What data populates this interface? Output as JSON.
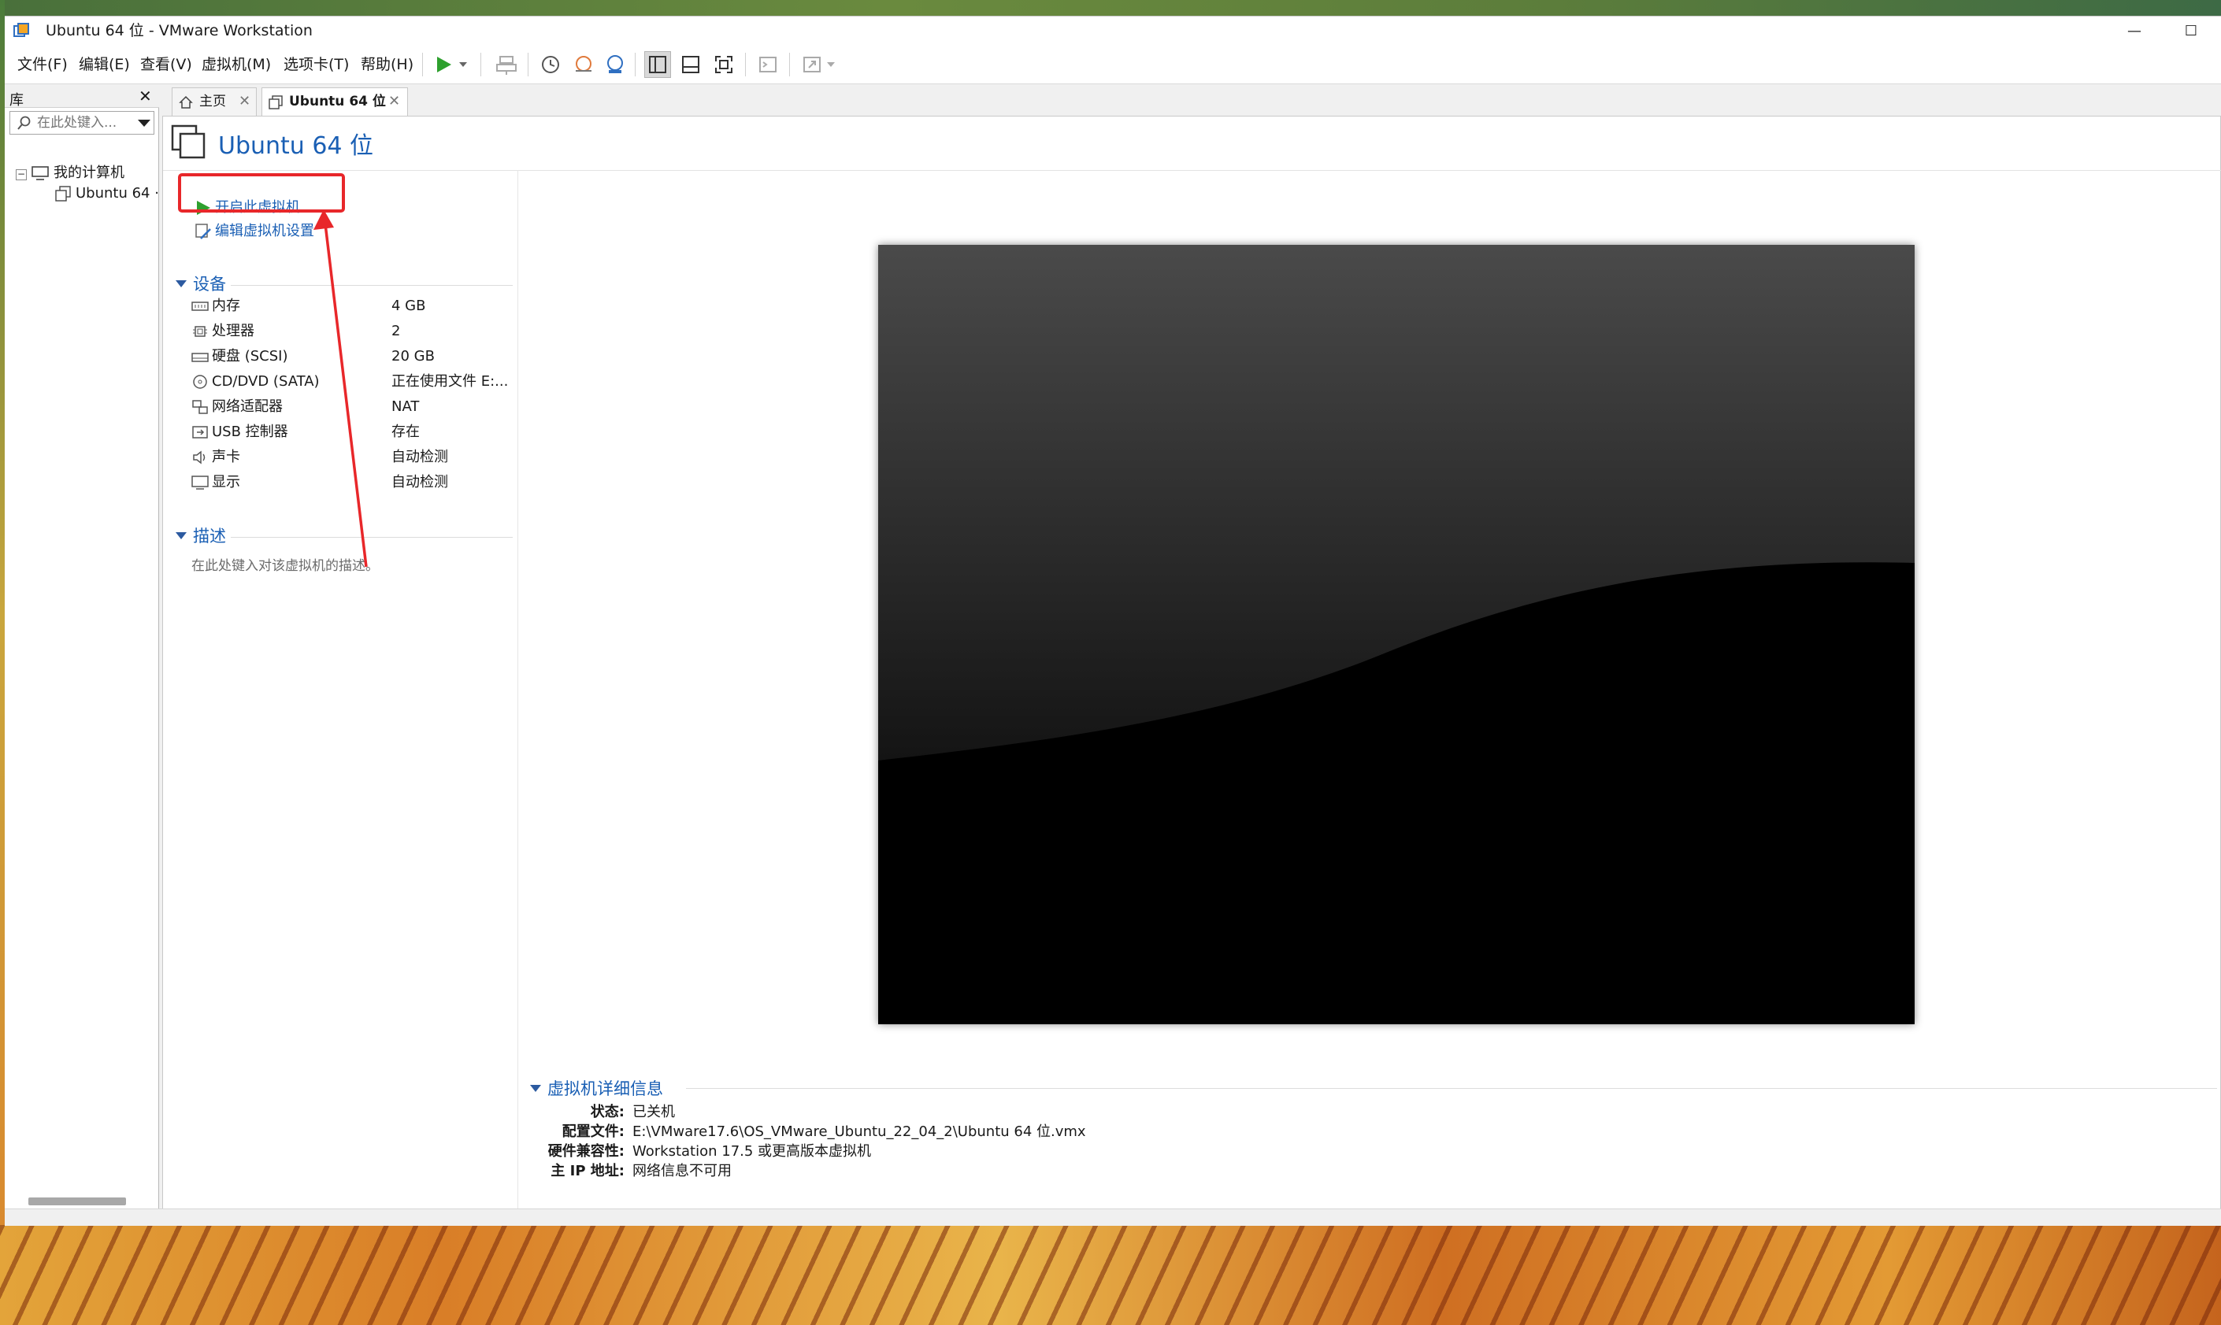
{
  "window": {
    "title": "Ubuntu 64 位 - VMware Workstation",
    "minimize_glyph": "—",
    "maximize_glyph": "☐"
  },
  "menu": {
    "file": "文件(F)",
    "edit": "编辑(E)",
    "view": "查看(V)",
    "vm": "虚拟机(M)",
    "tabs": "选项卡(T)",
    "help": "帮助(H)"
  },
  "library": {
    "title": "库",
    "close_glyph": "✕",
    "search_placeholder": "在此处键入...",
    "tree": {
      "root": "我的计算机",
      "child": "Ubuntu 64 ·"
    }
  },
  "tabs": [
    {
      "label": "主页",
      "close": "✕"
    },
    {
      "label": "Ubuntu 64 位",
      "close": "✕"
    }
  ],
  "vm": {
    "title": "Ubuntu 64 位",
    "actions": {
      "power_on": "开启此虚拟机",
      "edit_settings": "编辑虚拟机设置"
    },
    "devices": {
      "heading": "设备",
      "rows": [
        {
          "name": "内存",
          "value": "4 GB",
          "icon": "memory-icon"
        },
        {
          "name": "处理器",
          "value": "2",
          "icon": "cpu-icon"
        },
        {
          "name": "硬盘 (SCSI)",
          "value": "20 GB",
          "icon": "hard-disk-icon"
        },
        {
          "name": "CD/DVD (SATA)",
          "value": "正在使用文件 E:...",
          "icon": "cd-dvd-icon"
        },
        {
          "name": "网络适配器",
          "value": "NAT",
          "icon": "network-adapter-icon"
        },
        {
          "name": "USB 控制器",
          "value": "存在",
          "icon": "usb-icon"
        },
        {
          "name": "声卡",
          "value": "自动检测",
          "icon": "sound-icon"
        },
        {
          "name": "显示",
          "value": "自动检测",
          "icon": "display-icon"
        }
      ]
    },
    "description": {
      "heading": "描述",
      "placeholder": "在此处键入对该虚拟机的描述。"
    },
    "details": {
      "heading": "虚拟机详细信息",
      "rows": [
        {
          "key": "状态:",
          "value": "已关机"
        },
        {
          "key": "配置文件:",
          "value": "E:\\VMware17.6\\OS_VMware_Ubuntu_22_04_2\\Ubuntu 64 位.vmx"
        },
        {
          "key": "硬件兼容性:",
          "value": "Workstation 17.5 或更高版本虚拟机"
        },
        {
          "key": "主 IP 地址:",
          "value": "网络信息不可用"
        }
      ]
    }
  },
  "colors": {
    "accent": "#1a5fb4",
    "power_green": "#2ea02e",
    "annotation_red": "#e8272a"
  }
}
